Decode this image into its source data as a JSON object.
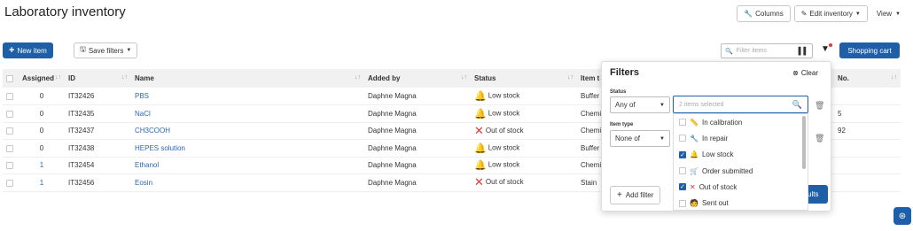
{
  "page": {
    "title": "Laboratory inventory"
  },
  "toolbar": {
    "columns": "Columns",
    "edit_inventory": "Edit inventory",
    "view": "View",
    "new_item": "New item",
    "save_filters": "Save filters",
    "search_placeholder": "Filter items",
    "shopping_cart": "Shopping cart"
  },
  "table": {
    "headers": {
      "assigned": "Assigned",
      "id": "ID",
      "name": "Name",
      "added_by": "Added by",
      "status": "Status",
      "item_type": "Item t",
      "no": "No."
    },
    "rows": [
      {
        "assigned": "0",
        "id": "IT32426",
        "name": "PBS",
        "added_by": "Daphne Magna",
        "status": "Low stock",
        "type": "Buffer",
        "no": "",
        "status_icon": "bell-icon"
      },
      {
        "assigned": "0",
        "id": "IT32435",
        "name": "NaCl",
        "added_by": "Daphne Magna",
        "status": "Low stock",
        "type": "Chemi",
        "no": "5",
        "status_icon": "bell-icon"
      },
      {
        "assigned": "0",
        "id": "IT32437",
        "name": "CH3COOH",
        "added_by": "Daphne Magna",
        "status": "Out of stock",
        "type": "Chemi",
        "no": "92",
        "status_icon": "x-icon"
      },
      {
        "assigned": "0",
        "id": "IT32438",
        "name": "HEPES solution",
        "added_by": "Daphne Magna",
        "status": "Low stock",
        "type": "Buffer",
        "no": "",
        "status_icon": "bell-icon"
      },
      {
        "assigned": "1",
        "id": "IT32454",
        "name": "Ethanol",
        "added_by": "Daphne Magna",
        "status": "Low stock",
        "type": "Chemi",
        "no": "",
        "status_icon": "bell-icon"
      },
      {
        "assigned": "1",
        "id": "IT32456",
        "name": "Eosin",
        "added_by": "Daphne Magna",
        "status": "Out of stock",
        "type": "Stain",
        "no": "",
        "status_icon": "x-icon"
      }
    ]
  },
  "filters": {
    "title": "Filters",
    "clear": "Clear",
    "status_label": "Status",
    "status_operator": "Any of",
    "status_value": "2 items selected",
    "item_type_label": "Item type",
    "item_type_operator": "None of",
    "add_filter": "Add filter",
    "apply": "ults",
    "options": [
      {
        "label": "In calibration",
        "checked": false,
        "icon": "ruler-icon"
      },
      {
        "label": "In repair",
        "checked": false,
        "icon": "wrench-icon"
      },
      {
        "label": "Low stock",
        "checked": true,
        "icon": "bell-icon"
      },
      {
        "label": "Order submitted",
        "checked": false,
        "icon": "cart-icon"
      },
      {
        "label": "Out of stock",
        "checked": true,
        "icon": "x-icon"
      },
      {
        "label": "Sent out",
        "checked": false,
        "icon": "person-icon"
      }
    ]
  },
  "colors": {
    "primary": "#1e5fa8",
    "link": "#2b66b8",
    "warning": "#f4a300",
    "danger": "#e53935"
  }
}
